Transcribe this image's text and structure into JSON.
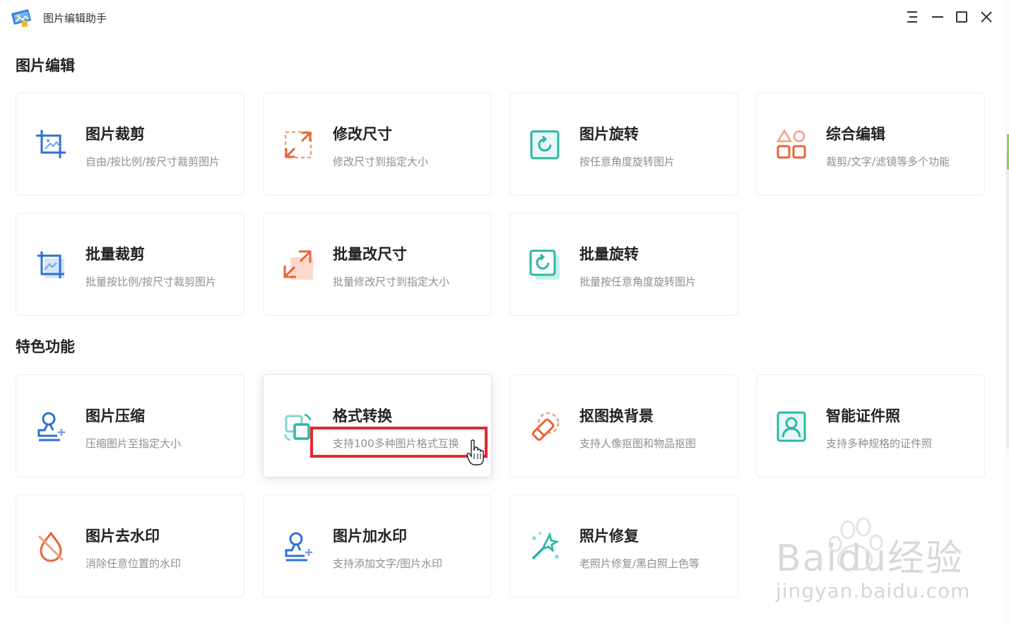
{
  "app": {
    "title": "图片编辑助手"
  },
  "sections": {
    "editing": {
      "title": "图片编辑"
    },
    "featured": {
      "title": "特色功能"
    }
  },
  "cards": {
    "crop": {
      "name": "图片裁剪",
      "desc": "自由/按比例/按尺寸裁剪图片",
      "icon": "crop-icon"
    },
    "resize": {
      "name": "修改尺寸",
      "desc": "修改尺寸到指定大小",
      "icon": "resize-icon"
    },
    "rotate": {
      "name": "图片旋转",
      "desc": "按任意角度旋转图片",
      "icon": "rotate-icon"
    },
    "edit": {
      "name": "综合编辑",
      "desc": "裁剪/文字/滤镜等多个功能",
      "icon": "shapes-icon"
    },
    "batch_crop": {
      "name": "批量裁剪",
      "desc": "批量按比例/按尺寸裁剪图片",
      "icon": "batch-crop-icon"
    },
    "batch_resize": {
      "name": "批量改尺寸",
      "desc": "批量修改尺寸到指定大小",
      "icon": "batch-resize-icon"
    },
    "batch_rotate": {
      "name": "批量旋转",
      "desc": "批量按任意角度旋转图片",
      "icon": "batch-rotate-icon"
    },
    "compress": {
      "name": "图片压缩",
      "desc": "压缩图片至指定大小",
      "icon": "compress-icon"
    },
    "convert": {
      "name": "格式转换",
      "desc": "支持100多种图片格式互换",
      "icon": "convert-icon"
    },
    "cutout": {
      "name": "抠图换背景",
      "desc": "支持人像抠图和物品抠图",
      "icon": "eraser-icon"
    },
    "id_photo": {
      "name": "智能证件照",
      "desc": "支持多种规格的证件照",
      "icon": "id-photo-icon"
    },
    "remove_wm": {
      "name": "图片去水印",
      "desc": "消除任意位置的水印",
      "icon": "remove-watermark-icon"
    },
    "add_wm": {
      "name": "图片加水印",
      "desc": "支持添加文字/图片水印",
      "icon": "add-watermark-icon"
    },
    "repair": {
      "name": "照片修复",
      "desc": "老照片修复/黑白照上色等",
      "icon": "magic-wand-icon"
    }
  },
  "watermark": {
    "brand": "Baidu经验",
    "url": "jingyan.baidu.com"
  },
  "colors": {
    "blue": "#2f6fd6",
    "orange": "#e8643a",
    "teal": "#2bb7a7",
    "highlight": "#e8262f"
  }
}
